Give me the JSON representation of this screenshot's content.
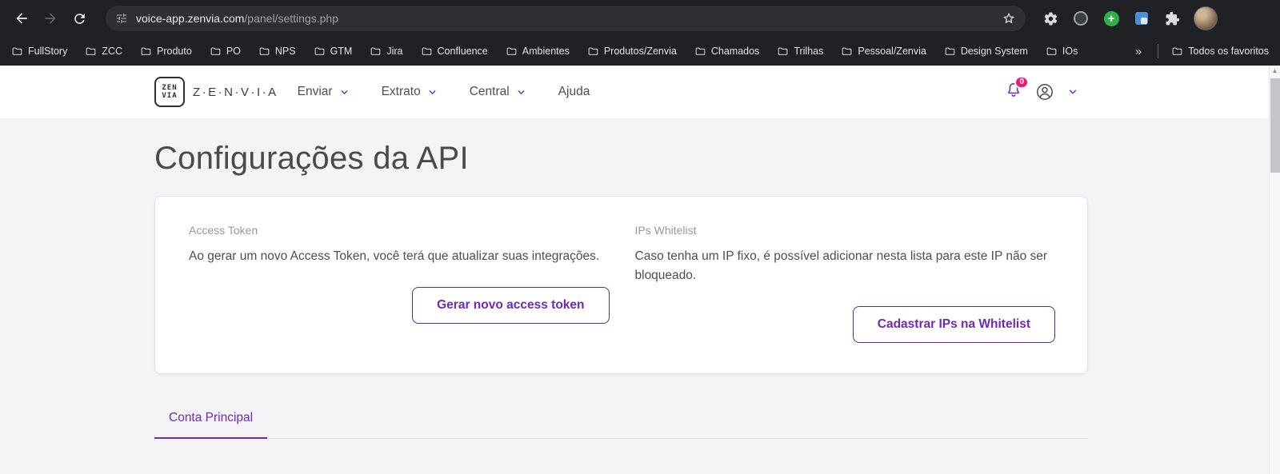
{
  "browser": {
    "url": {
      "host": "voice-app.zenvia.com",
      "path": "/panel/settings.php"
    },
    "bookmarks": [
      "FullStory",
      "ZCC",
      "Produto",
      "PO",
      "NPS",
      "GTM",
      "Jira",
      "Confluence",
      "Ambientes",
      "Produtos/Zenvia",
      "Chamados",
      "Trilhas",
      "Pessoal/Zenvia",
      "Design System",
      "IOs"
    ],
    "overflow_chevron": "»",
    "all_favorites": "Todos os favoritos"
  },
  "header": {
    "logo_top": "ZEN",
    "logo_bottom": "VIA",
    "brand": "Z·E·N·V·I·A",
    "nav": [
      "Enviar",
      "Extrato",
      "Central",
      "Ajuda"
    ],
    "notification_count": "0"
  },
  "page": {
    "title": "Configurações da API",
    "cards": {
      "access_token": {
        "label": "Access Token",
        "description": "Ao gerar um novo Access Token, você terá que atualizar suas integrações.",
        "button": "Gerar novo access token"
      },
      "ips_whitelist": {
        "label": "IPs Whitelist",
        "description": "Caso tenha um IP fixo, é possível adicionar nesta lista para este IP não ser bloqueado.",
        "button": "Cadastrar IPs na Whitelist"
      }
    },
    "tabs": [
      "Conta Principal"
    ]
  },
  "colors": {
    "accent": "#7127b8",
    "badge": "#ec1a77"
  }
}
